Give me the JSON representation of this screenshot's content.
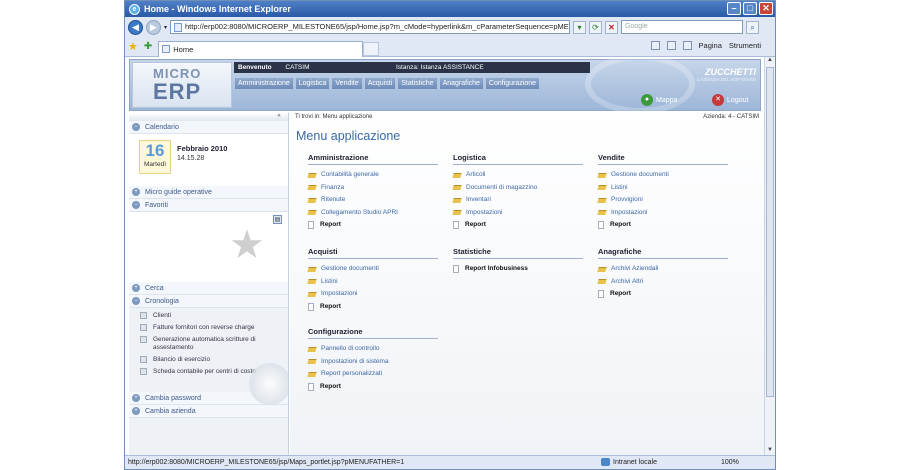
{
  "window": {
    "title": "Home - Windows Internet Explorer"
  },
  "browser": {
    "url": "http://erp002:8080/MICROERP_MILESTONE65/jsp/Home.jsp?m_cMode=hyperlink&m_cParameterSequence=pMENUFATHER",
    "search_placeholder": "Google",
    "tab_label": "Home",
    "cmd": {
      "page": "Pagina",
      "tools": "Strumenti"
    },
    "status_url": "http://erp002:8080/MICROERP_MILESTONE65/jsp/Maps_portlet.jsp?pMENUFATHER=1",
    "status_zone": "Intranet locale",
    "zoom": "100%"
  },
  "header": {
    "logo_top": "MICRO",
    "logo_bottom": "ERP",
    "welcome": "Benvenuto",
    "user": "CATSIM",
    "instance": "Istanza: Istanza ASSISTANCE",
    "menu": [
      "Amministrazione",
      "Logistica",
      "Vendite",
      "Acquisti",
      "Statistiche",
      "Anagrafiche",
      "Configurazione"
    ],
    "brand": "ZUCCHETTI",
    "brand_sub": "L'AZIENDA DEL SOFTWARE",
    "mappa": "Mappa",
    "logout": "Logout"
  },
  "sidebar": {
    "collapse": "«",
    "calendario": "Calendario",
    "day_num": "16",
    "weekday": "Martedì",
    "month": "Febbraio 2010",
    "time": "14.15.28",
    "guide": "Micro guide operative",
    "favoriti": "Favoriti",
    "cerca": "Cerca",
    "cronologia": "Cronologia",
    "history": [
      "Clienti",
      "Fatture fornitori con reverse charge",
      "Generazione automatica scritture di assestamento",
      "Bilancio di esercizio",
      "Scheda contabile per centri di costo"
    ],
    "cambia_password": "Cambia password",
    "cambia_azienda": "Cambia azienda"
  },
  "main": {
    "breadcrumb": "Ti trovi in:  Menu applicazione",
    "azienda": "Azienda: 4 - CATSIM",
    "title": "Menu applicazione",
    "sections": [
      {
        "title": "Amministrazione",
        "items": [
          "Contabilità generale",
          "Finanza",
          "Ritenute",
          "Collegamento Studio APRI"
        ],
        "report": "Report"
      },
      {
        "title": "Logistica",
        "items": [
          "Articoli",
          "Documenti di magazzino",
          "Inventari",
          "Impostazioni"
        ],
        "report": "Report"
      },
      {
        "title": "Vendite",
        "items": [
          "Gestione documenti",
          "Listini",
          "Provvigioni",
          "Impostazioni"
        ],
        "report": "Report"
      },
      {
        "title": "Acquisti",
        "items": [
          "Gestione documenti",
          "Listini",
          "Impostazioni"
        ],
        "report": "Report"
      },
      {
        "title": "Statistiche",
        "items": [],
        "report": "Report Infobusiness"
      },
      {
        "title": "Anagrafiche",
        "items": [
          "Archivi Aziendali",
          "Archivi Altri"
        ],
        "report": "Report"
      },
      {
        "title": "Configurazione",
        "items": [
          "Pannello di controllo",
          "Impostazioni di sistema",
          "Report personalizzati"
        ],
        "report": "Report"
      }
    ]
  }
}
